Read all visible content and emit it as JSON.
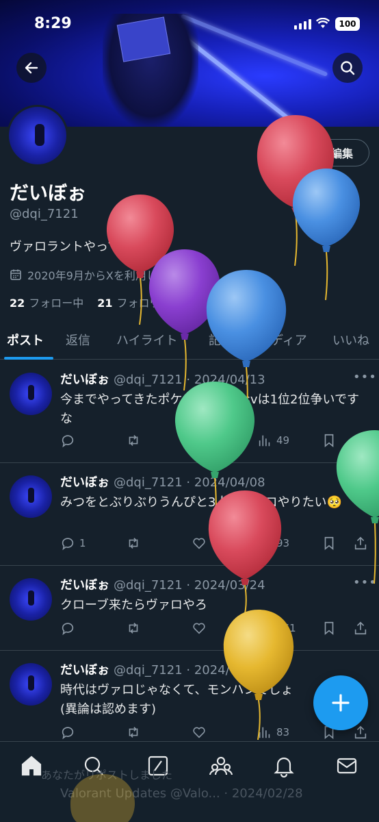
{
  "status_bar": {
    "time": "8:29",
    "battery": "100"
  },
  "header": {
    "back_icon": "arrow-left-icon",
    "search_icon": "search-icon"
  },
  "profile": {
    "name": "だいぼぉ",
    "handle": "@dqi_7121",
    "bio": "ヴァロラントやってます！",
    "joined": "2020年9月からXを利用しています",
    "following_count": "22",
    "following_label": "フォロー中",
    "followers_count": "21",
    "followers_label": "フォロワー",
    "edit_label": "編集"
  },
  "tabs": [
    {
      "label": "ポスト",
      "active": true
    },
    {
      "label": "返信"
    },
    {
      "label": "ハイライト"
    },
    {
      "label": "記事"
    },
    {
      "label": "メディア"
    },
    {
      "label": "いいね"
    }
  ],
  "tweets": [
    {
      "name": "だいぼぉ",
      "meta": "@dqi_7121 · 2024/04/13",
      "text": "今までやってきたポケモンの中でsvは1位2位争いですな",
      "replies": "",
      "likes": "",
      "views": "49"
    },
    {
      "name": "だいぼぉ",
      "meta": "@dqi_7121 · 2024/04/08",
      "text": "みつをとぶりぶりうんぴと3人でヴァロやりたい🥺",
      "replies": "1",
      "likes": "1",
      "views": "93"
    },
    {
      "name": "だいぼぉ",
      "meta": "@dqi_7121 · 2024/03/24",
      "text": "クローブ来たらヴァロやろ",
      "replies": "",
      "likes": "",
      "views": "161"
    },
    {
      "name": "だいぼぉ",
      "meta": "@dqi_7121 · 2024/03/08",
      "text": "時代はヴァロじゃなくて、モンハンでしょ(異論は認めます)",
      "replies": "",
      "likes": "",
      "views": "83"
    }
  ],
  "under_nav": {
    "repost_note": "あなたがリポストしました",
    "next_tweet": "Valorant Updates @Valo... · 2024/02/28"
  },
  "colors": {
    "background": "#15202b",
    "accent": "#1d9bf0",
    "balloon_red": "#d94a5c",
    "balloon_blue": "#4a90e2",
    "balloon_purple": "#8a3fd0",
    "balloon_green": "#4fc98a",
    "balloon_yellow": "#e6b830"
  },
  "nav_icons": [
    "home-icon",
    "search-icon",
    "grok-icon",
    "communities-icon",
    "notifications-icon",
    "messages-icon"
  ]
}
